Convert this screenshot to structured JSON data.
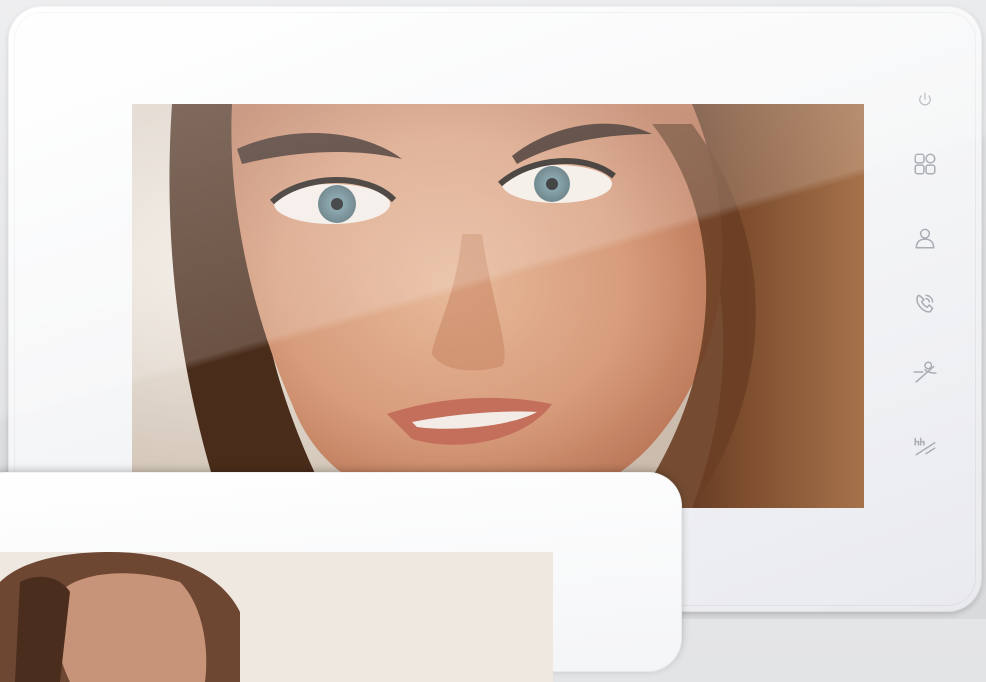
{
  "device": {
    "type": "video-door-intercom-monitor",
    "bezel_color": "#f5f6f8",
    "icon_color": "#a9adb4"
  },
  "controls": [
    {
      "id": "power",
      "icon": "power-icon"
    },
    {
      "id": "menu",
      "icon": "grid-menu-icon"
    },
    {
      "id": "monitor",
      "icon": "user-monitor-icon"
    },
    {
      "id": "talk",
      "icon": "handset-icon"
    },
    {
      "id": "unlock",
      "icon": "key-unlock-icon"
    },
    {
      "id": "door",
      "icon": "door-bell-icon"
    }
  ]
}
